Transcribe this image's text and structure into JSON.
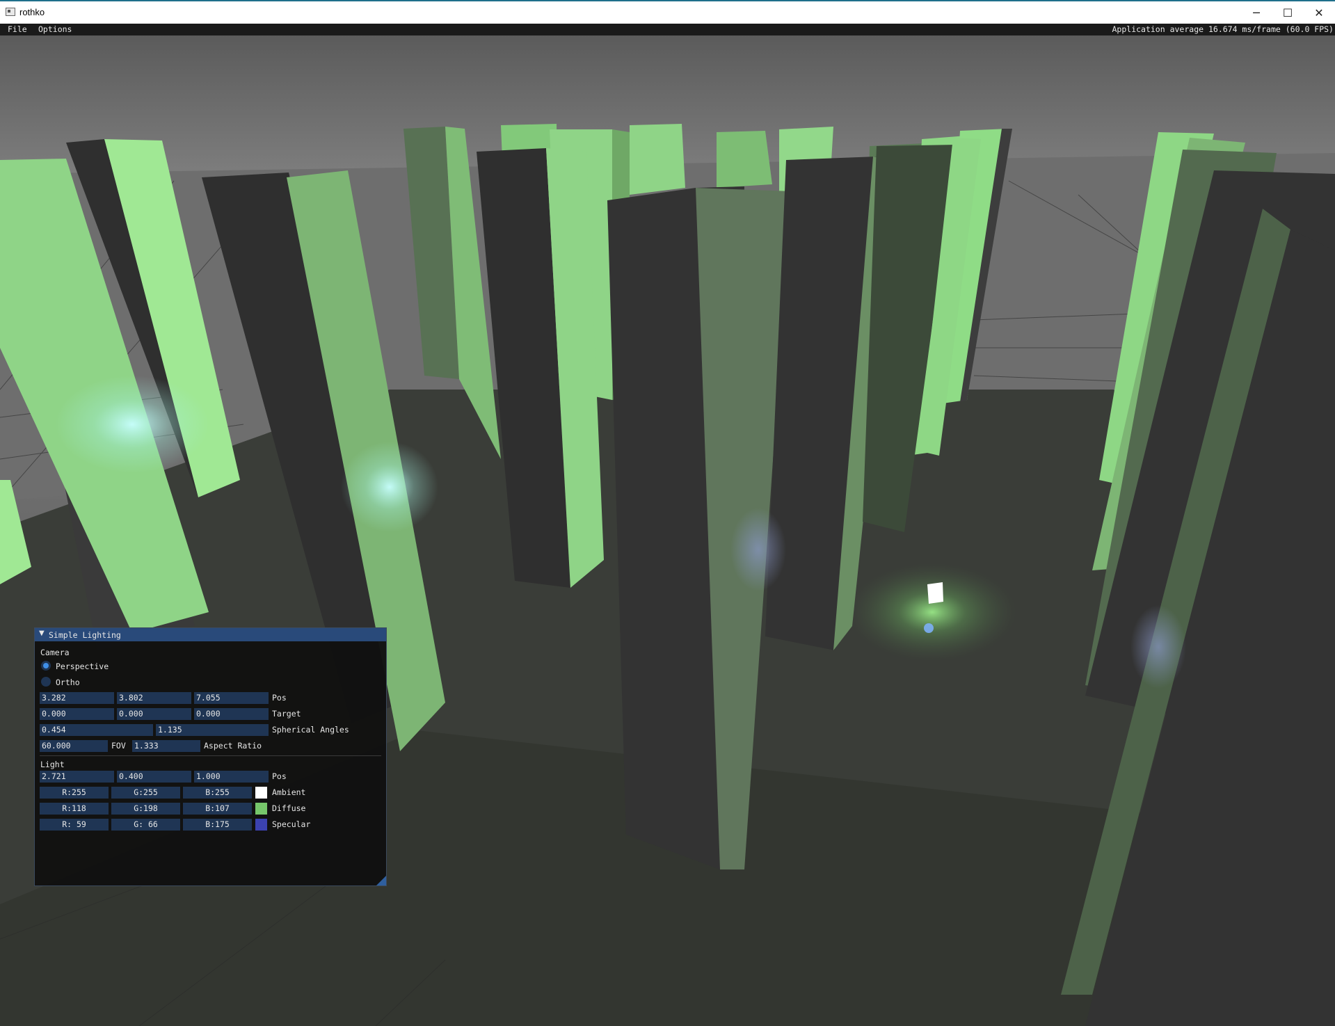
{
  "window": {
    "title": "rothko",
    "minimize_glyph": "─",
    "maximize_glyph": "☐",
    "close_glyph": "✕"
  },
  "menubar": {
    "file": "File",
    "options": "Options",
    "stats": "Application average 16.674 ms/frame (60.0 FPS)"
  },
  "panel": {
    "title": "Simple Lighting",
    "collapse_glyph": "▼",
    "camera": {
      "header": "Camera",
      "perspective_label": "Perspective",
      "ortho_label": "Ortho",
      "projection_selected": "Perspective",
      "pos": [
        "3.282",
        "3.802",
        "7.055"
      ],
      "pos_label": "Pos",
      "target": [
        "0.000",
        "0.000",
        "0.000"
      ],
      "target_label": "Target",
      "spherical": [
        "0.454",
        "1.135"
      ],
      "spherical_label": "Spherical Angles",
      "fov": "60.000",
      "fov_label": "FOV",
      "aspect": "1.333",
      "aspect_label": "Aspect Ratio"
    },
    "light": {
      "header": "Light",
      "pos": [
        "2.721",
        "0.400",
        "1.000"
      ],
      "pos_label": "Pos",
      "ambient": {
        "r": "R:255",
        "g": "G:255",
        "b": "B:255",
        "label": "Ambient",
        "color": "#ffffff"
      },
      "diffuse": {
        "r": "R:118",
        "g": "G:198",
        "b": "B:107",
        "label": "Diffuse",
        "color": "#76c66b"
      },
      "specular": {
        "r": "R: 59",
        "g": "G: 66",
        "b": "B:175",
        "label": "Specular",
        "color": "#3b42af"
      }
    }
  },
  "colors": {
    "menubar_bg": "#1a1a1a",
    "panel_header": "#294a7a",
    "field_bg": "#1f3554",
    "pillar_light": "#9fe596",
    "pillar_dark": "#333333"
  }
}
